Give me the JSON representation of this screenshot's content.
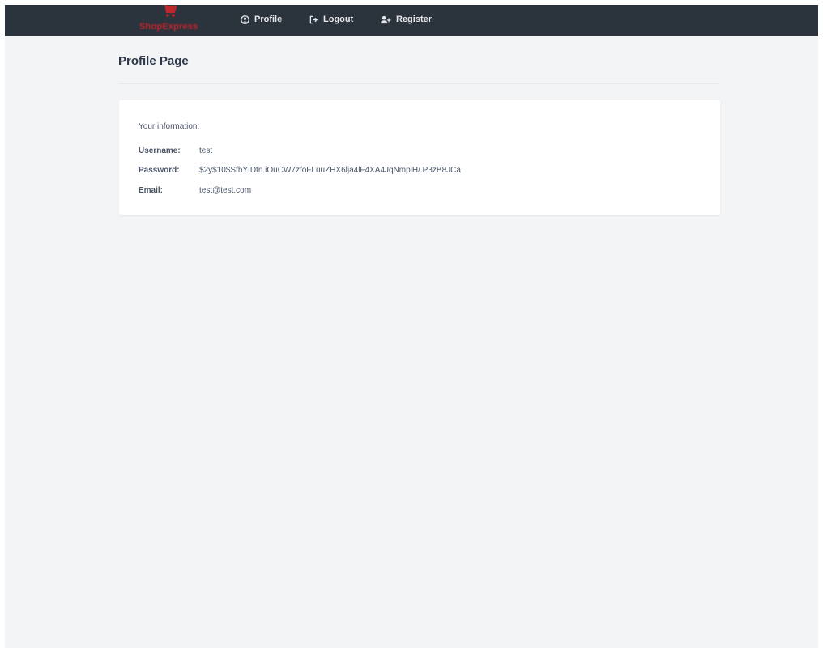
{
  "navbar": {
    "brand": "ShopExpress",
    "items": [
      {
        "label": "Profile",
        "icon": "user-circle-icon"
      },
      {
        "label": "Logout",
        "icon": "sign-out-icon"
      },
      {
        "label": "Register",
        "icon": "user-plus-icon"
      }
    ]
  },
  "page": {
    "title": "Profile Page"
  },
  "profile": {
    "heading": "Your information:",
    "fields": [
      {
        "label": "Username:",
        "value": "test"
      },
      {
        "label": "Password:",
        "value": "$2y$10$SfhYIDtn.iOuCW7zfoFLuuZHX6lja4lF4XA4JqNmpiH/.P3zB8JCa"
      },
      {
        "label": "Email:",
        "value": "test@test.com"
      }
    ]
  },
  "colors": {
    "navbar_bg": "#2b333d",
    "page_bg": "#f3f4f6",
    "brand_red": "#c0262d",
    "text": "#4a5568"
  }
}
